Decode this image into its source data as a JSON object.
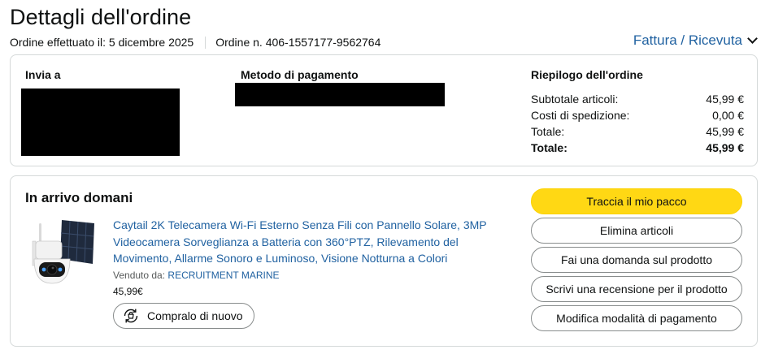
{
  "header": {
    "title": "Dettagli dell'ordine",
    "order_date": "Ordine effettuato il: 5 dicembre 2025",
    "order_number": "Ordine n. 406-1557177-9562764",
    "invoice_link": "Fattura / Ricevuta"
  },
  "summary": {
    "ship_to_title": "Invia a",
    "payment_title": "Metodo di pagamento",
    "order_summary_title": "Riepilogo dell'ordine",
    "rows": [
      {
        "label": "Subtotale articoli:",
        "value": "45,99 €"
      },
      {
        "label": "Costi di spedizione:",
        "value": "0,00 €"
      },
      {
        "label": "Totale:",
        "value": "45,99 €"
      },
      {
        "label": "Totale:",
        "value": "45,99 €"
      }
    ]
  },
  "order": {
    "arrival": "In arrivo domani",
    "product_title": "Caytail 2K Telecamera Wi-Fi Esterno Senza Fili con Pannello Solare, 3MP Videocamera Sorveglianza a Batteria con 360°PTZ, Rilevamento del Movimento, Allarme Sonoro e Luminoso, Visione Notturna a Colori",
    "sold_by_label": "Venduto da:",
    "seller_name": "RECRUITMENT MARINE",
    "price": "45,99€",
    "buy_again": "Compralo di nuovo"
  },
  "actions": {
    "track": "Traccia il mio pacco",
    "delete": "Elimina articoli",
    "question": "Fai una domanda sul prodotto",
    "review": "Scrivi una recensione per il prodotto",
    "payment": "Modifica modalità di pagamento"
  },
  "colors": {
    "link": "#2162a1",
    "primary_button": "#ffd814",
    "border": "#d5d9d9"
  },
  "icons": {
    "invoice_dropdown": "chevron-down-icon",
    "buy_again": "rebuy-icon"
  }
}
